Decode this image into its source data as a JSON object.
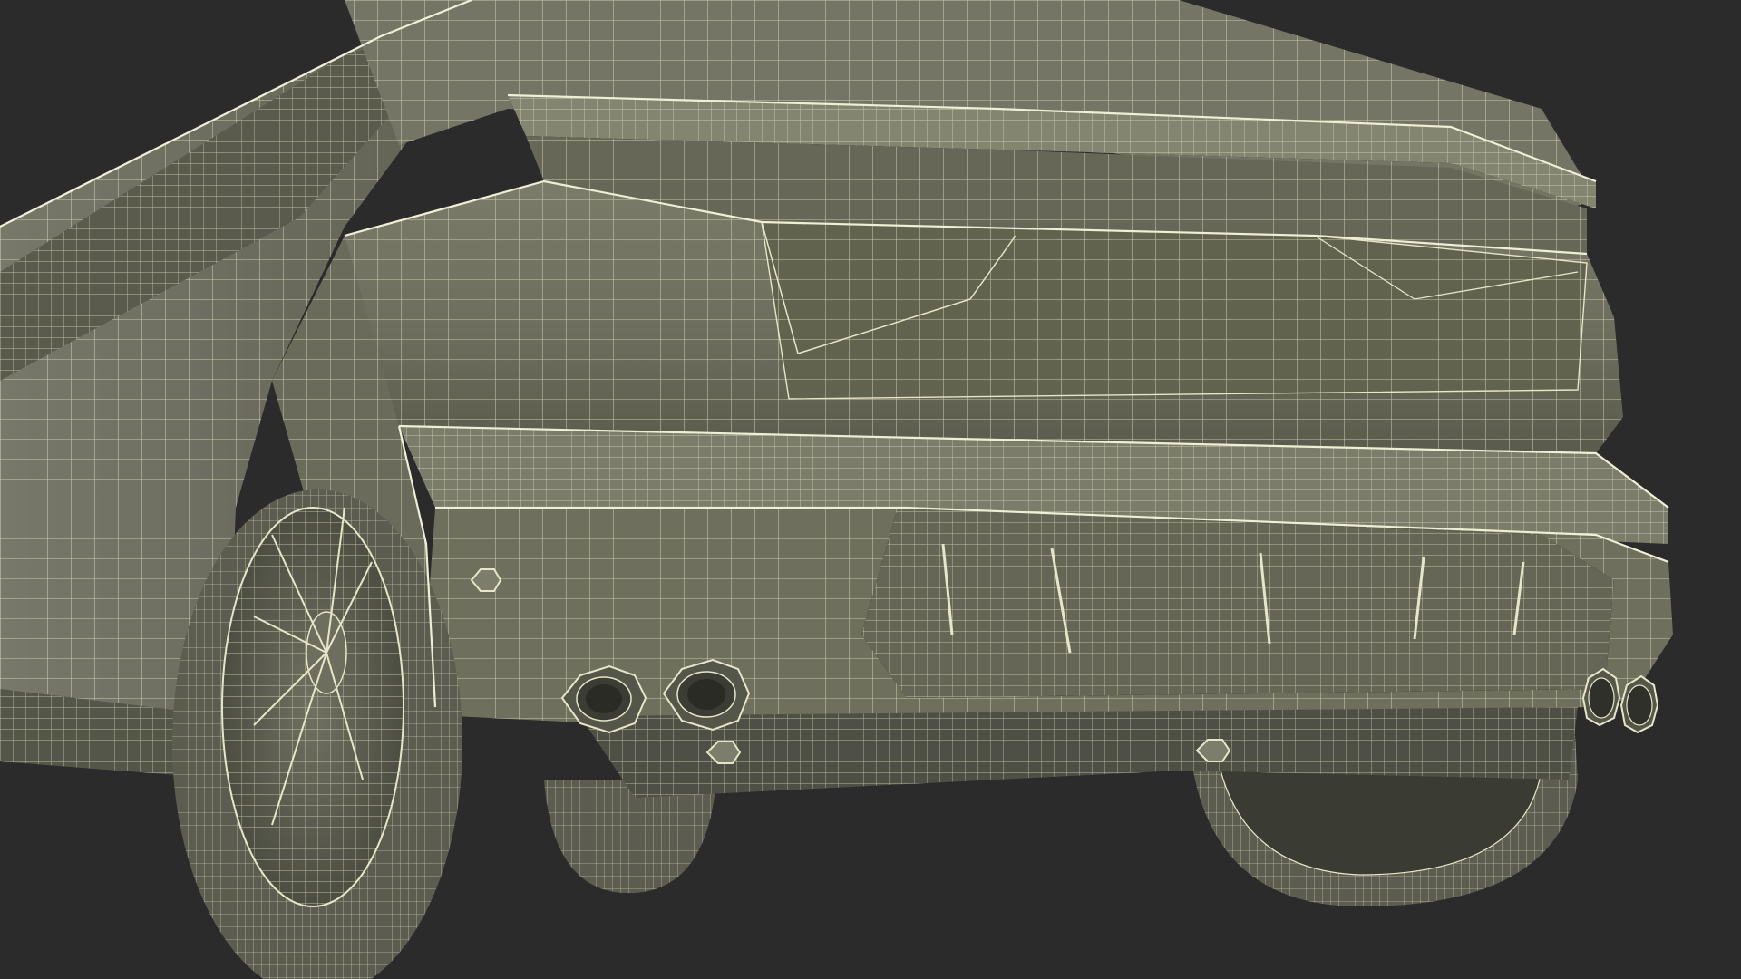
{
  "scene": {
    "background_color": "#2b2b2b",
    "surface_color": "#6f705f",
    "surface_shadow_color": "#4e4f43",
    "surface_highlight_color": "#8a8b78",
    "wire_color": "#e8e6c8",
    "tire_color": "#5f6052"
  }
}
